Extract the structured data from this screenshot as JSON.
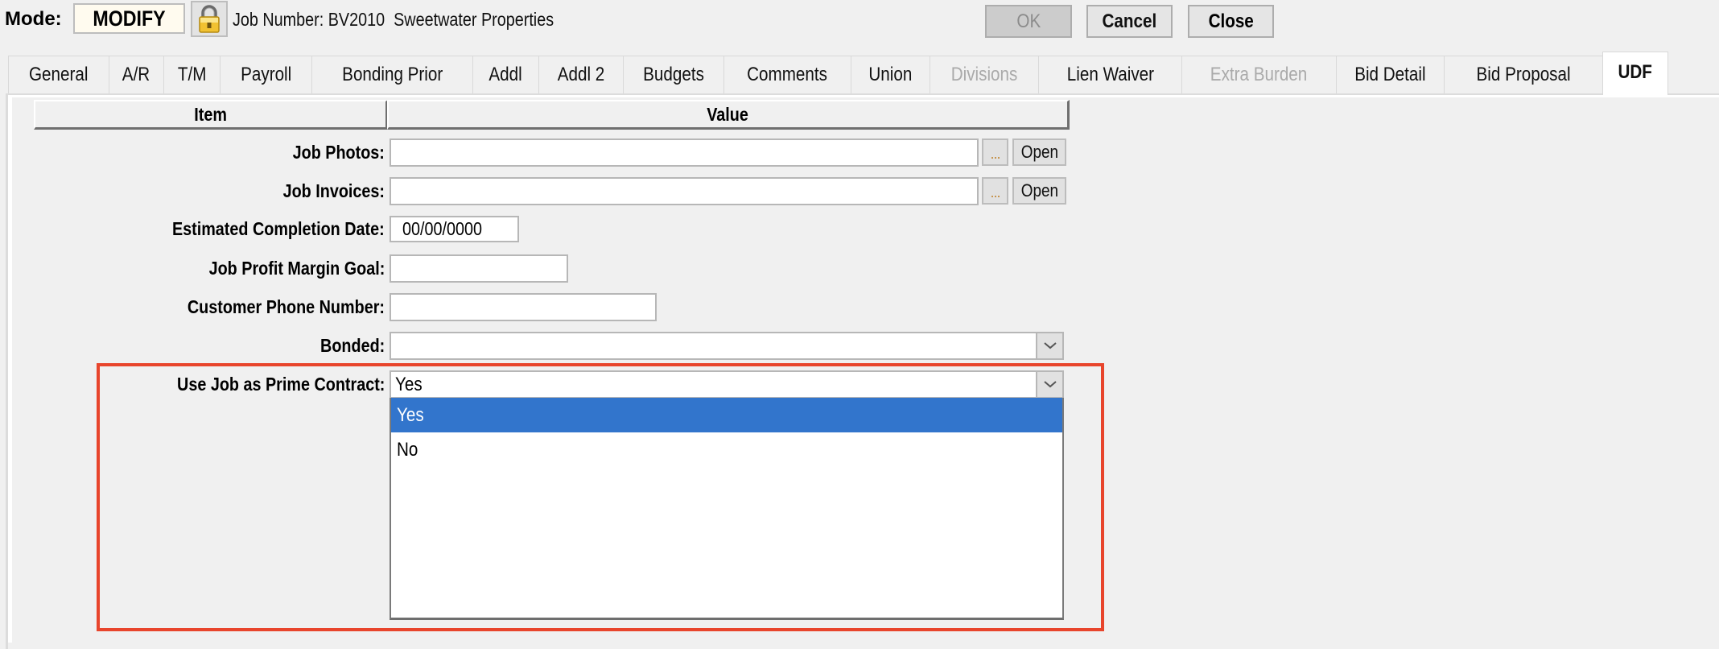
{
  "header": {
    "mode_label": "Mode:",
    "mode_value": "MODIFY",
    "lock_icon": "lock-icon",
    "job_text": "Job Number: BV2010  Sweetwater Properties"
  },
  "toolbar": {
    "ok_label": "OK",
    "cancel_label": "Cancel",
    "close_label": "Close"
  },
  "tabs": [
    {
      "label": "General",
      "state": "normal"
    },
    {
      "label": "A/R",
      "state": "normal"
    },
    {
      "label": "T/M",
      "state": "normal"
    },
    {
      "label": "Payroll",
      "state": "normal"
    },
    {
      "label": "Bonding Prior",
      "state": "normal"
    },
    {
      "label": "Addl",
      "state": "normal"
    },
    {
      "label": "Addl 2",
      "state": "normal"
    },
    {
      "label": "Budgets",
      "state": "normal"
    },
    {
      "label": "Comments",
      "state": "normal"
    },
    {
      "label": "Union",
      "state": "normal"
    },
    {
      "label": "Divisions",
      "state": "disabled"
    },
    {
      "label": "Lien Waiver",
      "state": "normal"
    },
    {
      "label": "Extra Burden",
      "state": "disabled"
    },
    {
      "label": "Bid Detail",
      "state": "normal"
    },
    {
      "label": "Bid Proposal",
      "state": "normal"
    },
    {
      "label": "UDF",
      "state": "active"
    }
  ],
  "grid": {
    "columns": [
      "Item",
      "Value"
    ],
    "rows": [
      {
        "label": "Job Photos:",
        "type": "file",
        "value": "",
        "browse_label": "...",
        "open_label": "Open"
      },
      {
        "label": "Job Invoices:",
        "type": "file",
        "value": "",
        "browse_label": "...",
        "open_label": "Open"
      },
      {
        "label": "Estimated Completion Date:",
        "type": "date",
        "value": "00/00/0000"
      },
      {
        "label": "Job Profit Margin Goal:",
        "type": "text",
        "value": ""
      },
      {
        "label": "Customer Phone Number:",
        "type": "text",
        "value": ""
      },
      {
        "label": "Bonded:",
        "type": "select",
        "value": ""
      },
      {
        "label": "Use Job as Prime Contract:",
        "type": "select",
        "value": "Yes"
      }
    ]
  },
  "dropdown": {
    "open_for": "Use Job as Prime Contract:",
    "options": [
      "Yes",
      "No"
    ],
    "selected": "Yes"
  },
  "colors": {
    "selection": "#3275cc",
    "highlight_box": "#e8452c",
    "active_tab": "#ffffff",
    "background": "#f0f0f0"
  }
}
